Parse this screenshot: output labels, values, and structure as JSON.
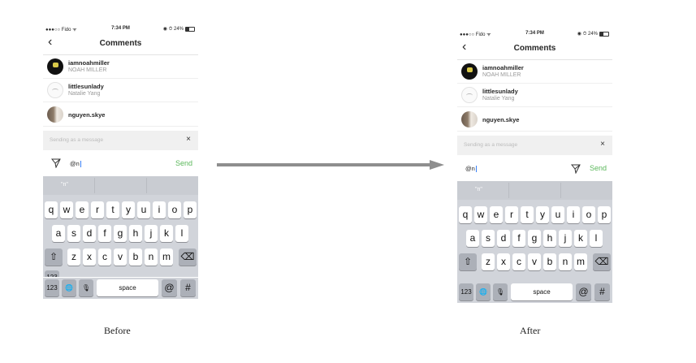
{
  "status": {
    "carrier": "●●●○○ Fido ᯤ",
    "time": "7:34 PM",
    "right": "◉ ⏱ 24%"
  },
  "nav": {
    "title": "Comments",
    "back": "‹"
  },
  "comments": [
    {
      "username": "iamnoahmiller",
      "fullname": "NOAH MILLER"
    },
    {
      "username": "littlesunlady",
      "fullname": "Natalie Yang"
    },
    {
      "username": "nguyen.skye",
      "fullname": ""
    }
  ],
  "message_bar": {
    "text": "Sending as a message",
    "close": "×"
  },
  "input": {
    "value": "@n",
    "send_label": "Send"
  },
  "keyboard": {
    "suggestion": "\"n\"",
    "row1": [
      "q",
      "w",
      "e",
      "r",
      "t",
      "y",
      "u",
      "i",
      "o",
      "p"
    ],
    "row2": [
      "a",
      "s",
      "d",
      "f",
      "g",
      "h",
      "j",
      "k",
      "l"
    ],
    "row3": [
      "z",
      "x",
      "c",
      "v",
      "b",
      "n",
      "m"
    ],
    "shift": "⇧",
    "backspace": "⌫",
    "numbers": "123",
    "globe": "🌐",
    "mic": "🎙",
    "space": "space",
    "at": "@",
    "hash": "#"
  },
  "captions": {
    "before": "Before",
    "after": "After"
  },
  "colors": {
    "send": "#5cb85c",
    "arrow": "#8e8e8e",
    "keyboard": "#d1d4da"
  }
}
